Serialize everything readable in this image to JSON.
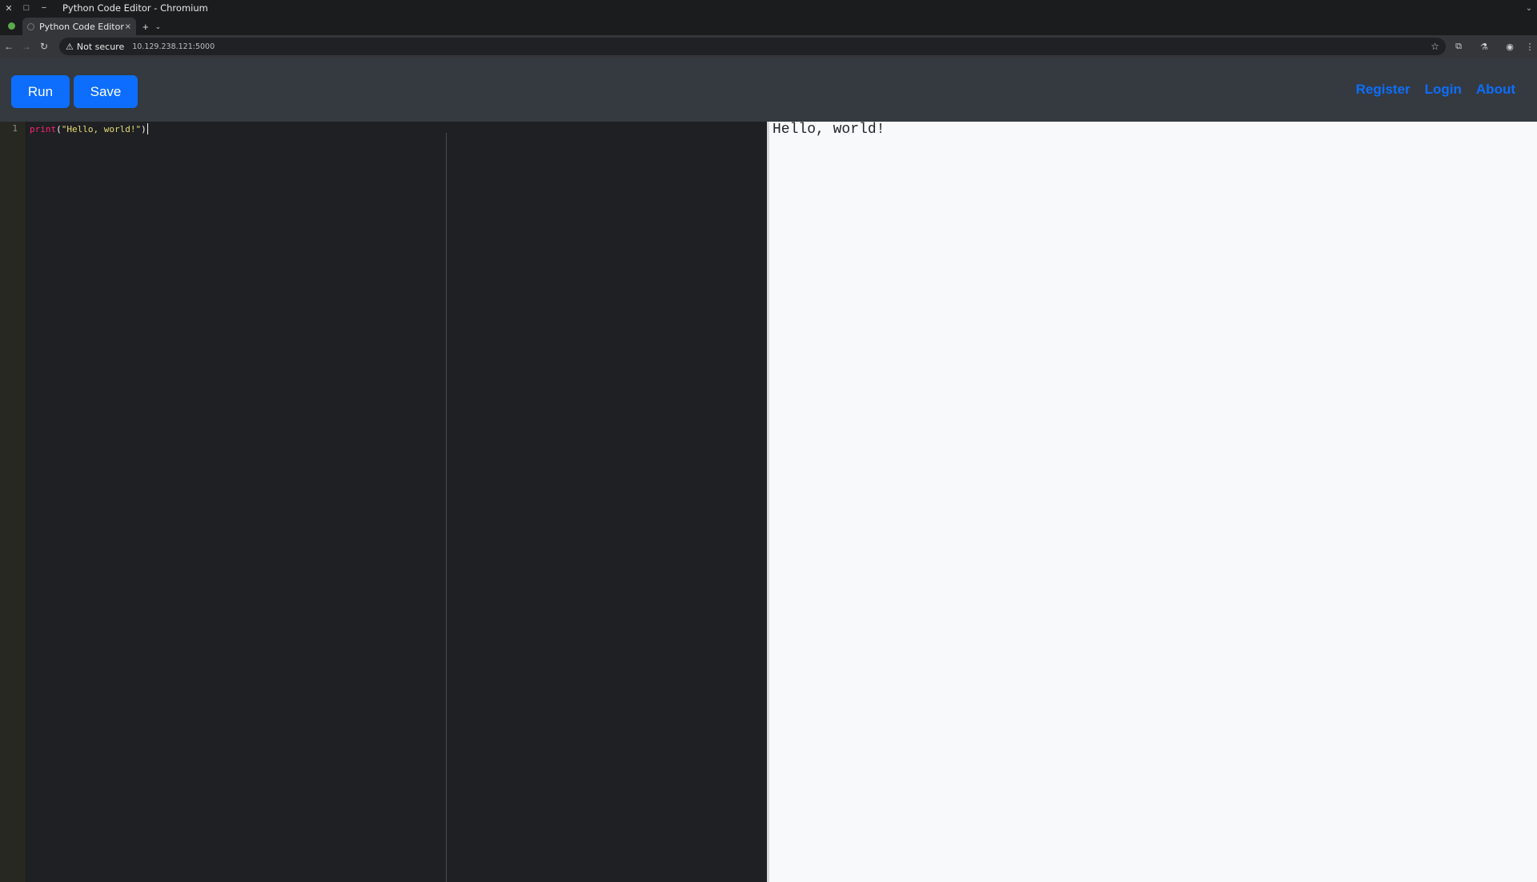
{
  "window": {
    "title": "Python Code Editor - Chromium",
    "close_glyph": "✕",
    "maximize_glyph": "□",
    "minimize_glyph": "−",
    "menu_glyph": "⌄"
  },
  "tabs": [
    {
      "label": "Python Code Editor",
      "close_glyph": "×"
    }
  ],
  "tabstrip": {
    "new_tab_glyph": "+",
    "menu_glyph": "⌄"
  },
  "addressbar": {
    "back_glyph": "←",
    "forward_glyph": "→",
    "reload_glyph": "↻",
    "warning_glyph": "⚠",
    "security_label": "Not secure",
    "url": "10.129.238.121:5000",
    "bookmark_glyph": "☆",
    "extension_glyph": "⧉",
    "labs_glyph": "⚗",
    "profile_glyph": "◉",
    "menu_glyph": "⋮"
  },
  "header": {
    "run_label": "Run",
    "save_label": "Save",
    "nav": {
      "register": "Register",
      "login": "Login",
      "about": "About"
    }
  },
  "editor": {
    "language": "python",
    "line_numbers": [
      "1"
    ],
    "code": {
      "fn": "print",
      "open": "(",
      "str": "\"Hello, world!\"",
      "close": ")"
    }
  },
  "output": {
    "text": "Hello, world!"
  },
  "colors": {
    "primary": "#0d6efd",
    "header_bg": "#343a40",
    "editor_bg": "#1f2023",
    "output_bg": "#f8f9fa"
  }
}
